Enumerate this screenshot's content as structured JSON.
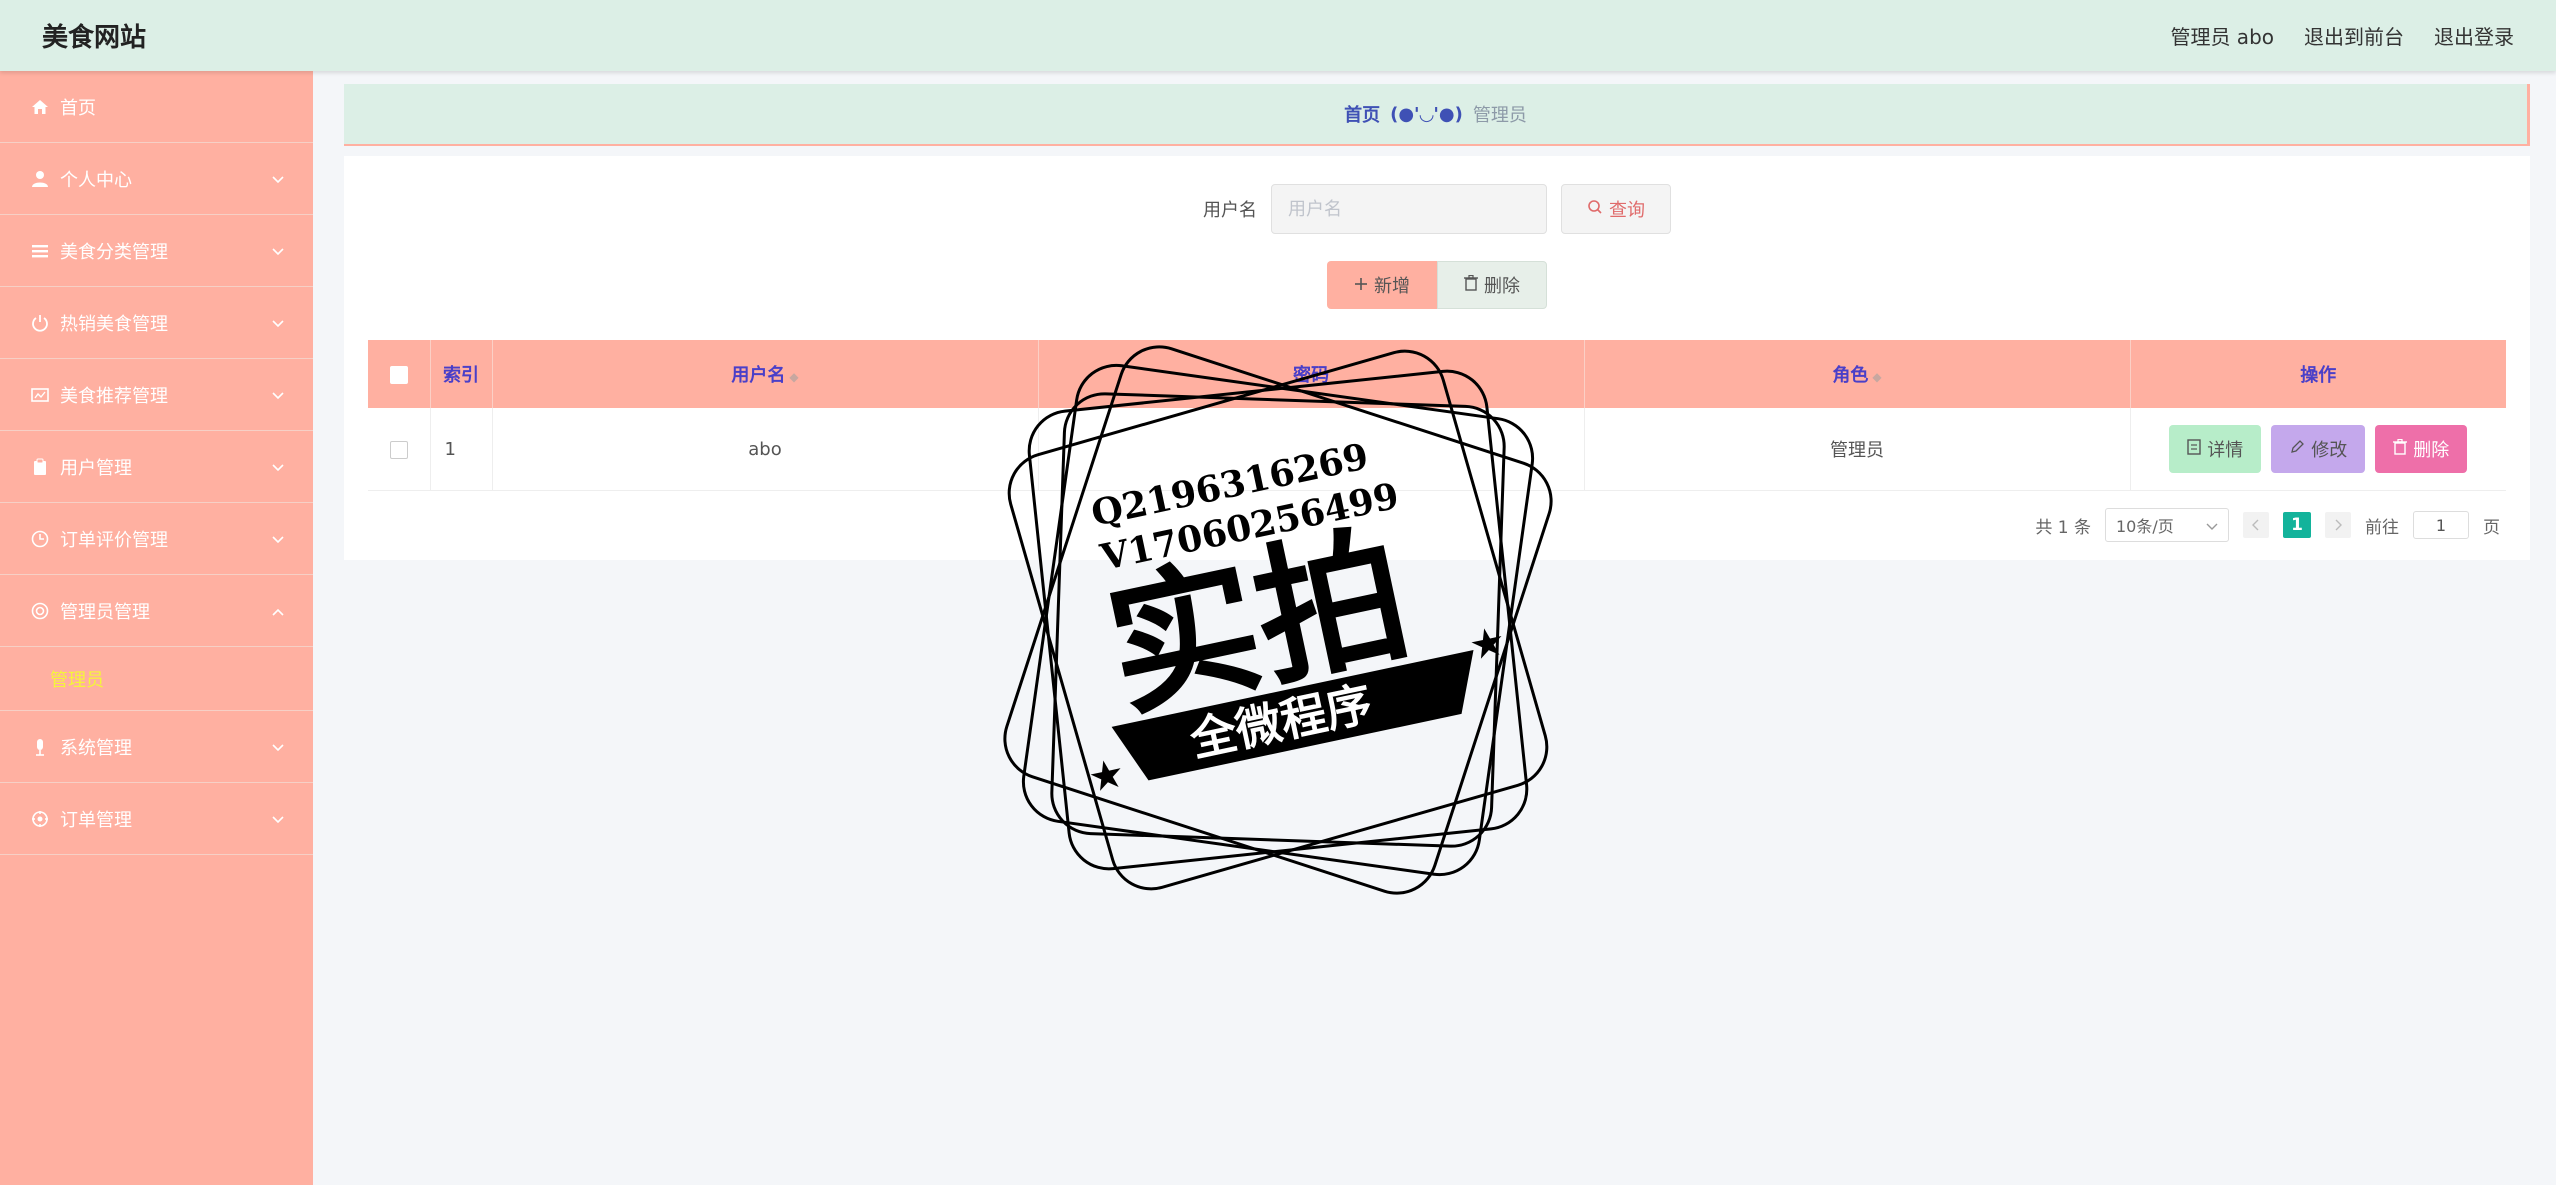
{
  "header": {
    "brand": "美食网站",
    "user_label": "管理员 abo",
    "to_front": "退出到前台",
    "logout": "退出登录"
  },
  "sidebar": {
    "items": [
      {
        "label": "首页",
        "icon": "home-icon",
        "has_chevron": false
      },
      {
        "label": "个人中心",
        "icon": "user-icon",
        "has_chevron": true
      },
      {
        "label": "美食分类管理",
        "icon": "list-icon",
        "has_chevron": true
      },
      {
        "label": "热销美食管理",
        "icon": "power-icon",
        "has_chevron": true
      },
      {
        "label": "美食推荐管理",
        "icon": "board-icon",
        "has_chevron": true
      },
      {
        "label": "用户管理",
        "icon": "clipboard-icon",
        "has_chevron": true
      },
      {
        "label": "订单评价管理",
        "icon": "clock-icon",
        "has_chevron": true
      },
      {
        "label": "管理员管理",
        "icon": "life-ring-icon",
        "has_chevron": true,
        "expanded": true
      },
      {
        "label": "系统管理",
        "icon": "mic-icon",
        "has_chevron": true
      },
      {
        "label": "订单管理",
        "icon": "cog-icon",
        "has_chevron": true
      }
    ],
    "sub_item": "管理员"
  },
  "breadcrumb": {
    "home": "首页",
    "emoji": "(●'◡'●)",
    "current": "管理员"
  },
  "search": {
    "label": "用户名",
    "placeholder": "用户名",
    "query_button": "查询"
  },
  "actions": {
    "add": "新增",
    "delete": "删除"
  },
  "table": {
    "columns": [
      "索引",
      "用户名",
      "密码",
      "角色",
      "操作"
    ],
    "rows": [
      {
        "index": "1",
        "username": "abo",
        "password": "",
        "role": "管理员"
      }
    ],
    "row_buttons": {
      "detail": "详情",
      "edit": "修改",
      "remove": "删除"
    }
  },
  "pager": {
    "total": "共 1 条",
    "page_size": "10条/页",
    "current_page": "1",
    "goto_label": "前往",
    "goto_value": "1",
    "page_unit": "页"
  },
  "watermark": {
    "line1": "Q2196316269",
    "line2": "V17060256499",
    "big": "实拍",
    "banner": "全微程序"
  },
  "colors": {
    "accent": "#ffb0a1",
    "header_bg": "#dcefe6",
    "link": "#3f51b5",
    "active_page": "#13b39b"
  }
}
